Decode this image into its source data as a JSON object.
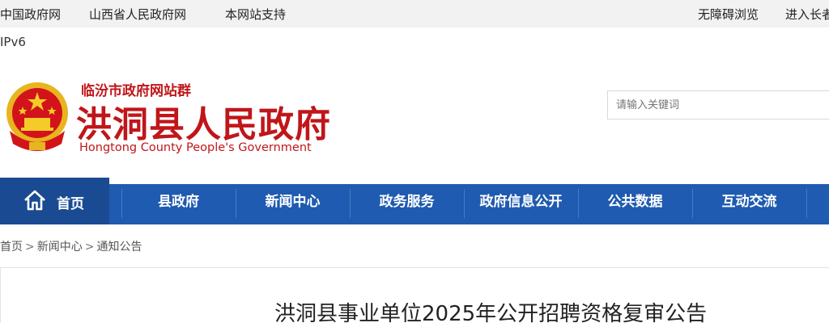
{
  "topbar": {
    "left_links": [
      "中国政府网",
      "山西省人民政府网",
      "本网站支持"
    ],
    "right_links": [
      "无障碍浏览",
      "进入长者"
    ]
  },
  "ipv6_label": "IPv6",
  "header": {
    "site_group": "临汾市政府网站群",
    "title": "洪洞县人民政府",
    "subtitle_en": "Hongtong County People's Government",
    "emblem_icon": "national-emblem-icon"
  },
  "search": {
    "placeholder": "请输入关键词"
  },
  "nav": {
    "home_label": "首页",
    "items": [
      "县政府",
      "新闻中心",
      "政务服务",
      "政府信息公开",
      "公共数据",
      "互动交流"
    ]
  },
  "breadcrumb": [
    "首页",
    "新闻中心",
    "通知公告"
  ],
  "breadcrumb_separator": ">",
  "article": {
    "title": "洪洞县事业单位2025年公开招聘资格复审公告"
  },
  "colors": {
    "brand_red": "#c0161a",
    "nav_blue": "#1f5bb0",
    "nav_home_blue": "#1a4b92"
  }
}
